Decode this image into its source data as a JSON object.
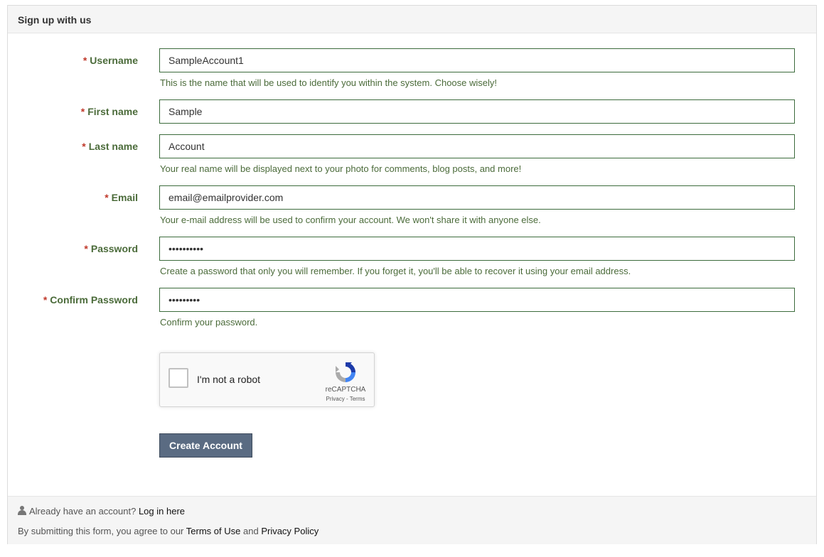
{
  "panel": {
    "title": "Sign up with us"
  },
  "form": {
    "required_marker": "*",
    "username": {
      "label": "Username",
      "value": "SampleAccount1",
      "help": "This is the name that will be used to identify you within the system. Choose wisely!"
    },
    "first_name": {
      "label": "First name",
      "value": "Sample"
    },
    "last_name": {
      "label": "Last name",
      "value": "Account",
      "help": "Your real name will be displayed next to your photo for comments, blog posts, and more!"
    },
    "email": {
      "label": "Email",
      "value": "email@emailprovider.com",
      "help": "Your e-mail address will be used to confirm your account. We won't share it with anyone else."
    },
    "password": {
      "label": "Password",
      "value": "samplepwd1",
      "help": "Create a password that only you will remember. If you forget it, you'll be able to recover it using your email address."
    },
    "confirm_password": {
      "label": "Confirm Password",
      "value": "samplepwd",
      "help": "Confirm your password."
    },
    "captcha": {
      "label": "I'm not a robot",
      "brand": "reCAPTCHA",
      "links": "Privacy - Terms",
      "icon": "recaptcha-icon"
    },
    "submit_label": "Create Account"
  },
  "footer": {
    "login_prompt": "Already have an account?",
    "login_link": "Log in here",
    "agree_prefix": "By submitting this form, you agree to our",
    "terms_link": "Terms of Use",
    "and_text": "and",
    "privacy_link": "Privacy Policy",
    "user_icon": "user-icon"
  },
  "colors": {
    "label_green": "#4b6b3a",
    "required_red": "#c0392b",
    "field_border": "#3c6b3c",
    "button_bg": "#5a6b82"
  }
}
